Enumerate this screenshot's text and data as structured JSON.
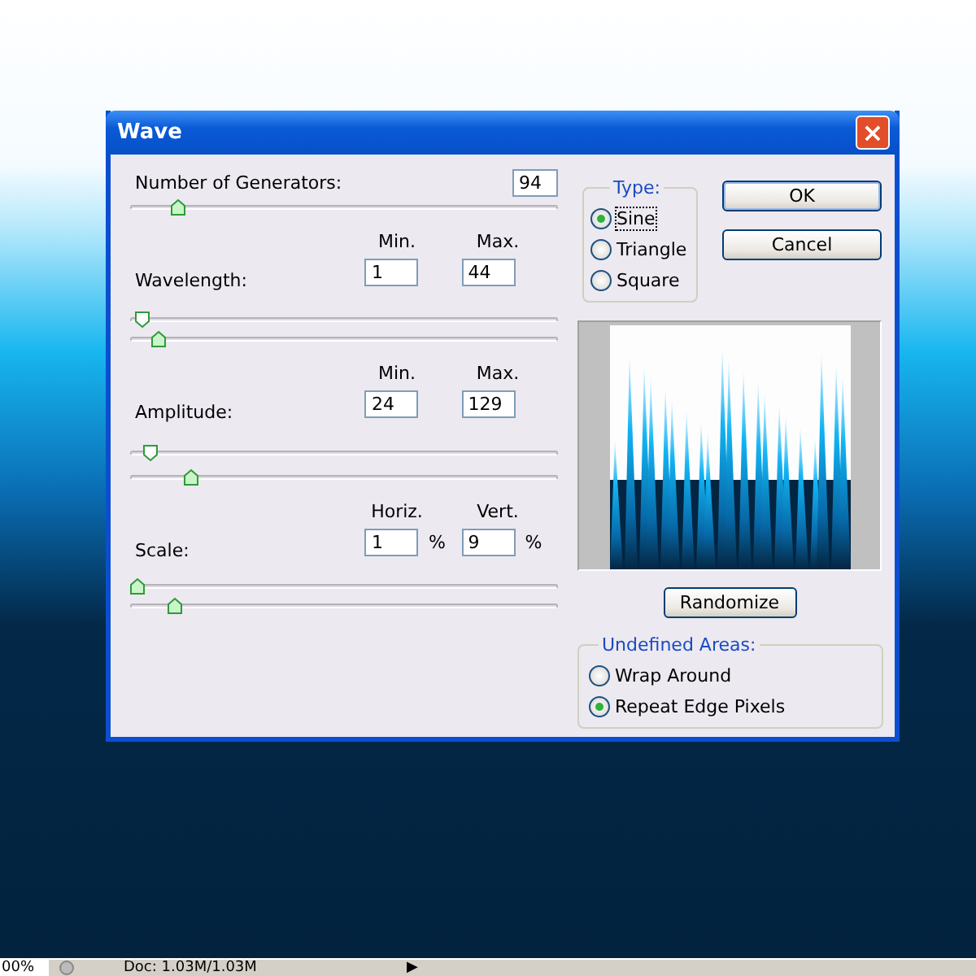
{
  "dialog": {
    "title": "Wave",
    "close": "×"
  },
  "generators": {
    "label": "Number of Generators:",
    "value": "94",
    "level": 0.1
  },
  "ranges": [
    {
      "label": "Wavelength:",
      "headers": [
        "Min.",
        "Max."
      ],
      "fields": [
        {
          "value": "1"
        },
        {
          "value": "44"
        }
      ],
      "sliders": [
        {
          "kind": "down",
          "level": 0.01
        },
        {
          "kind": "up",
          "level": 0.05
        }
      ]
    },
    {
      "label": "Amplitude:",
      "headers": [
        "Min.",
        "Max."
      ],
      "fields": [
        {
          "value": "24"
        },
        {
          "value": "129"
        }
      ],
      "sliders": [
        {
          "kind": "down",
          "level": 0.03
        },
        {
          "kind": "up",
          "level": 0.13
        }
      ]
    },
    {
      "label": "Scale:",
      "headers": [
        "Horiz.",
        "Vert."
      ],
      "fields": [
        {
          "value": "1",
          "unit": "%"
        },
        {
          "value": "9",
          "unit": "%"
        }
      ],
      "sliders": [
        {
          "kind": "up",
          "level": 0.0
        },
        {
          "kind": "up",
          "level": 0.09
        }
      ]
    }
  ],
  "type": {
    "legend": "Type:",
    "options": [
      {
        "label": "Sine",
        "selected": true
      },
      {
        "label": "Triangle",
        "selected": false
      },
      {
        "label": "Square",
        "selected": false
      }
    ]
  },
  "buttons": [
    "OK",
    "Cancel"
  ],
  "randomize": "Randomize",
  "undefined_areas": {
    "legend": "Undefined Areas:",
    "options": [
      {
        "label": "Wrap Around",
        "selected": false
      },
      {
        "label": "Repeat Edge Pixels",
        "selected": true
      }
    ]
  },
  "status_bar": {
    "zoom": "00%",
    "doc": "Doc: 1.03M/1.03M",
    "arrow": "▶"
  }
}
